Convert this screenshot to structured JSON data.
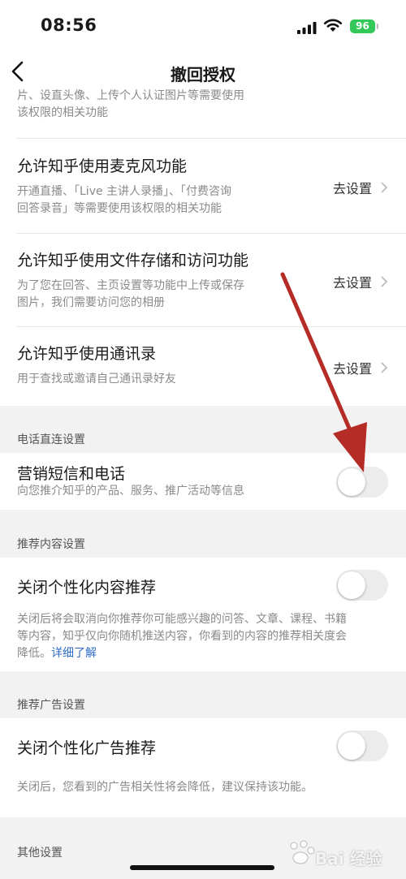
{
  "status_bar": {
    "time": "08:56",
    "battery": "96"
  },
  "nav": {
    "title": "撤回授权"
  },
  "partial_top": {
    "desc_line1": "片、设直头像、上传个人认证图片等需要使用",
    "desc_line2": "该权限的相关功能"
  },
  "permissions": [
    {
      "title": "允许知乎使用麦克风功能",
      "desc1": "开通直播、「Live 主讲人录播」、「付费咨询",
      "desc2": "回答录音」等需要使用该权限的相关功能",
      "action": "去设置"
    },
    {
      "title": "允许知乎使用文件存储和访问功能",
      "desc1": "为了您在回答、主页设置等功能中上传或保存",
      "desc2": "图片，我们需要访问您的相册",
      "action": "去设置"
    },
    {
      "title": "允许知乎使用通讯录",
      "desc1": "用于查找或邀请自己通讯录好友",
      "action": "去设置"
    }
  ],
  "phone_section": {
    "header": "电话直连设置",
    "item": {
      "title": "营销短信和电话",
      "desc": "向您推介知乎的产品、服务、推广活动等信息",
      "enabled": false
    }
  },
  "content_section": {
    "header": "推荐内容设置",
    "item": {
      "title": "关闭个性化内容推荐",
      "desc1": "关闭后将会取消向你推荐你可能感兴趣的问答、文章、课程、书籍",
      "desc2": "等内容，知乎仅向你随机推送内容，你看到的内容的推荐相关度会",
      "desc3": "降低。",
      "link": "详细了解",
      "enabled": false
    }
  },
  "ad_section": {
    "header": "推荐广告设置",
    "item": {
      "title": "关闭个性化广告推荐",
      "desc": "关闭后，您看到的广告相关性将会降低，建议保持该功能。",
      "enabled": false
    }
  },
  "other_section": {
    "header": "其他设置"
  },
  "watermark": {
    "text": "Bai 经验"
  },
  "colors": {
    "accent_link": "#2f6cc7",
    "arrow": "#b52b25",
    "battery": "#34c759"
  }
}
